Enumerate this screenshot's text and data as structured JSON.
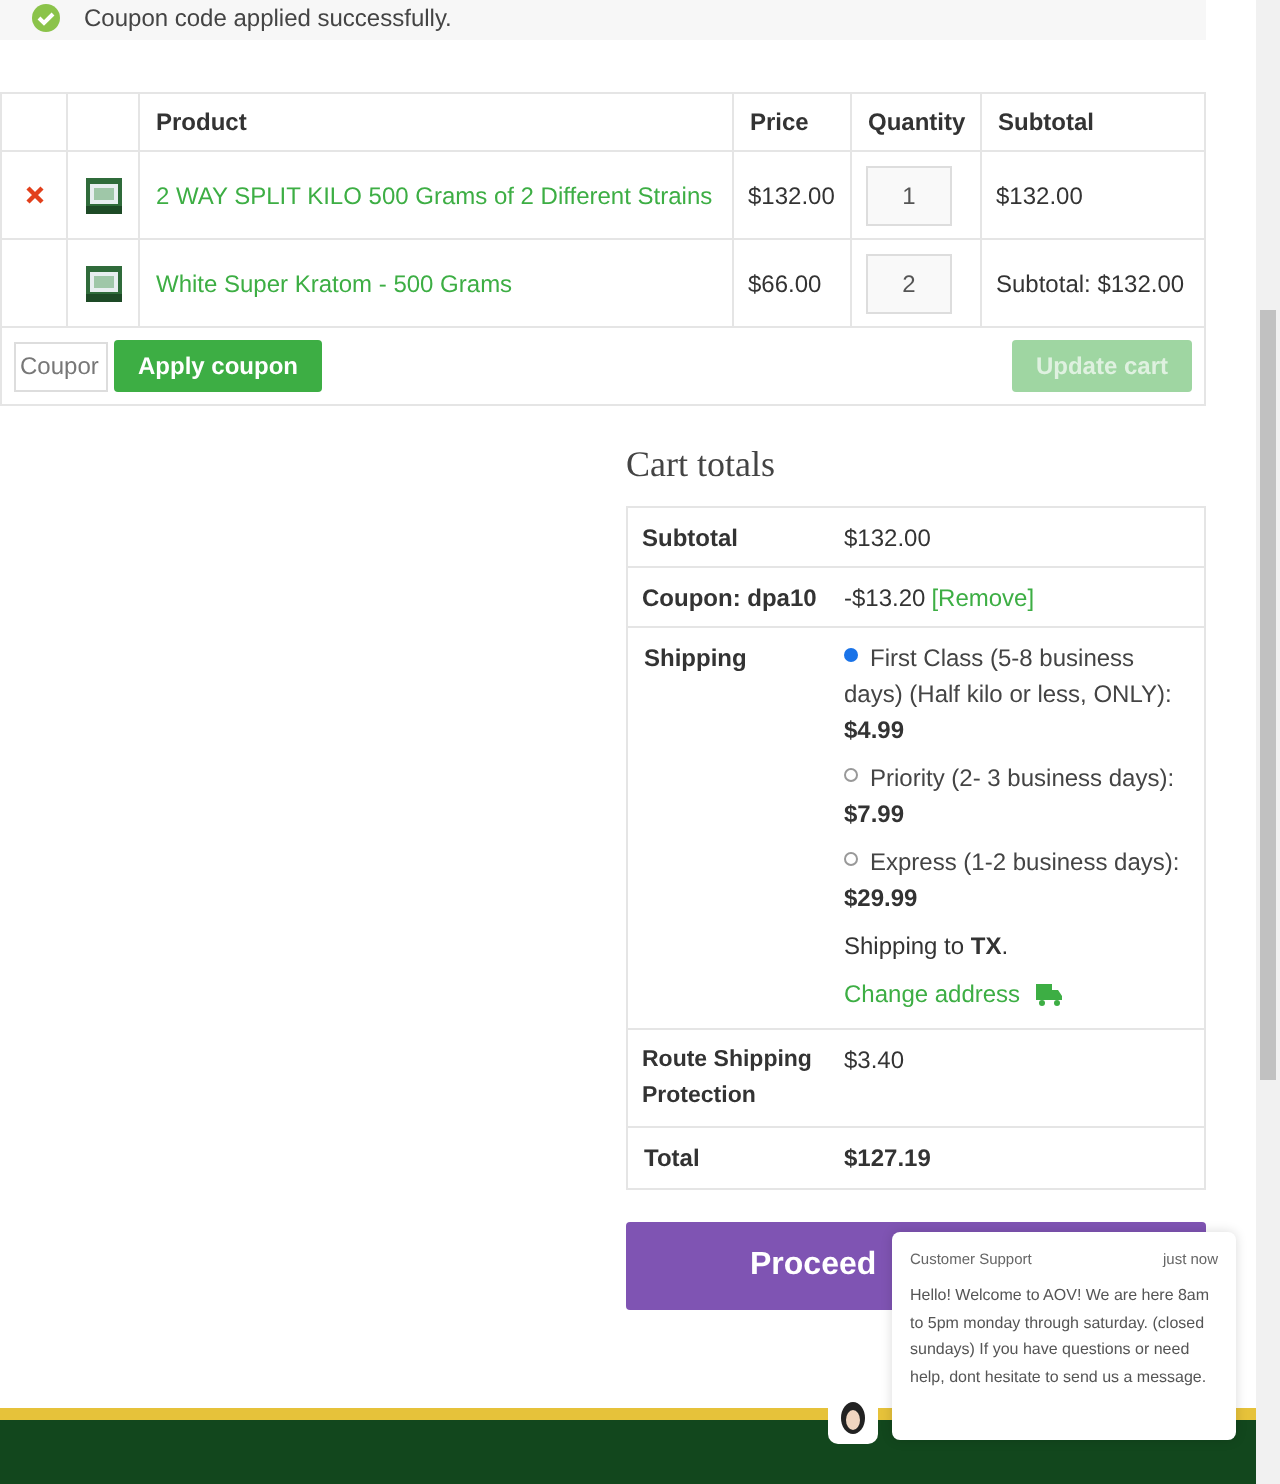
{
  "notice": {
    "text": "Coupon code applied successfully."
  },
  "cart_table": {
    "columns": [
      "Product",
      "Price",
      "Quantity",
      "Subtotal"
    ],
    "rows": [
      {
        "removable": true,
        "product": "2 WAY SPLIT KILO 500 Grams of 2 Different Strains",
        "price": "$132.00",
        "quantity": "1",
        "subtotal": "$132.00"
      },
      {
        "removable": false,
        "product": "White Super Kratom - 500 Grams",
        "price": "$66.00",
        "quantity": "2",
        "subtotal": "Subtotal: $132.00"
      }
    ],
    "coupon_field": {
      "placeholder": "Coupor"
    },
    "apply_button": "Apply coupon",
    "update_button": {
      "label": "Update cart",
      "disabled": true
    }
  },
  "cart_totals": {
    "title": "Cart totals",
    "subtotal": {
      "label": "Subtotal",
      "value": "$132.00"
    },
    "coupon": {
      "label": "Coupon: dpa10",
      "value": "-$13.20",
      "remove_link": "[Remove]"
    },
    "shipping": {
      "label": "Shipping",
      "options": [
        {
          "name": "First Class (5-8 business days) (Half kilo or less, ONLY):",
          "price": "$4.99",
          "selected": true
        },
        {
          "name": "Priority (2- 3 business days):",
          "price": "$7.99",
          "selected": false
        },
        {
          "name": "Express (1-2 business days):",
          "price": "$29.99",
          "selected": false
        }
      ],
      "destination": "Shipping to **TX**.",
      "change_address": "Change address"
    },
    "route_protection": {
      "label": "Route Shipping Protection",
      "value": "$3.40"
    },
    "total": {
      "label": "Total",
      "value": "$127.19"
    },
    "checkout_button": "Proceed"
  },
  "chat": {
    "sender": "Customer Support",
    "time": "just now",
    "message": "Hello! Welcome to AOV! We are here 8am to 5pm monday through saturday. (closed sundays) If you have questions or need help, dont hesitate to send us a message."
  }
}
